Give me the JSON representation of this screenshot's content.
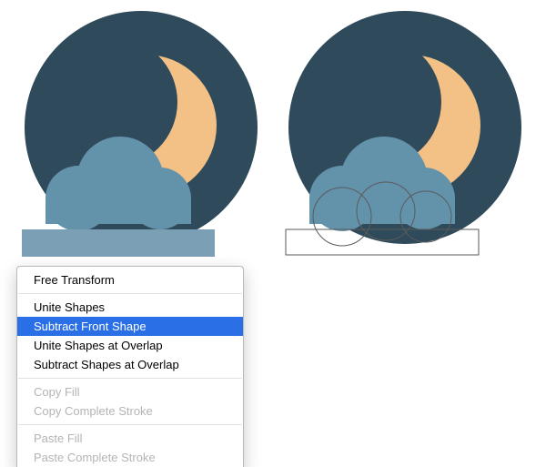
{
  "colors": {
    "circle_bg": "#2f4a5a",
    "moon": "#f3c185",
    "cloud": "#6392ab",
    "cloud_band": "#7ba0b6",
    "outline": "#5a5a5a",
    "menu_highlight": "#2a6fe6"
  },
  "menu": {
    "items": [
      {
        "label": "Free Transform",
        "type": "item"
      },
      {
        "type": "sep"
      },
      {
        "label": "Unite Shapes",
        "type": "item"
      },
      {
        "label": "Subtract Front Shape",
        "type": "item",
        "selected": true
      },
      {
        "label": "Unite Shapes at Overlap",
        "type": "item"
      },
      {
        "label": "Subtract Shapes at Overlap",
        "type": "item"
      },
      {
        "type": "sep"
      },
      {
        "label": "Copy Fill",
        "type": "item",
        "disabled": true
      },
      {
        "label": "Copy Complete Stroke",
        "type": "item",
        "disabled": true
      },
      {
        "type": "sep"
      },
      {
        "label": "Paste Fill",
        "type": "item",
        "disabled": true
      },
      {
        "label": "Paste Complete Stroke",
        "type": "item",
        "disabled": true
      }
    ]
  }
}
